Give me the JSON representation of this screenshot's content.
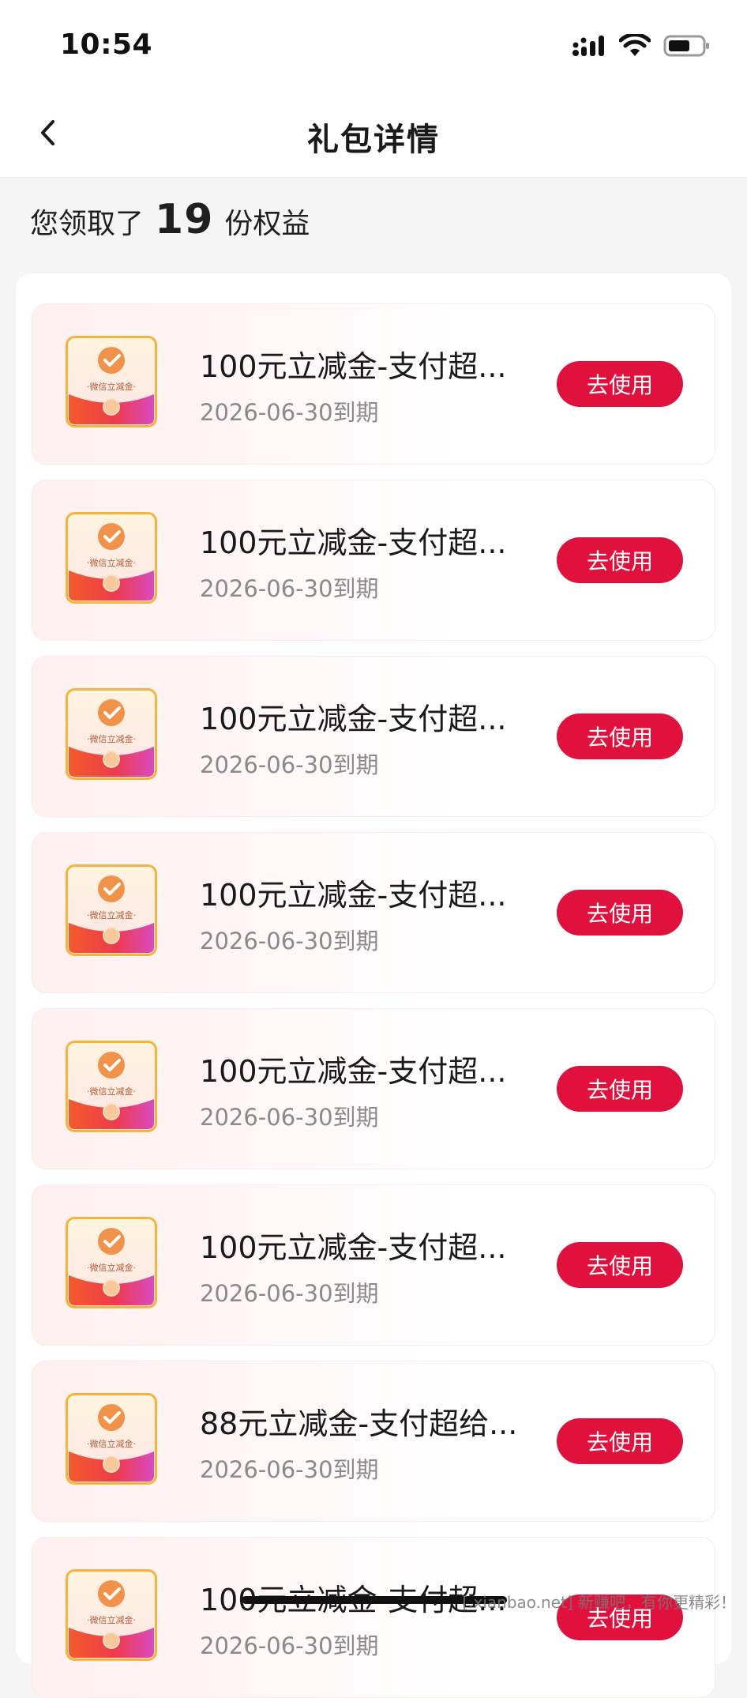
{
  "status_bar": {
    "time": "10:54"
  },
  "nav": {
    "title": "礼包详情"
  },
  "summary": {
    "prefix": "您领取了",
    "count": "19",
    "suffix": "份权益"
  },
  "coupon_badge_text": "·微信立减金·",
  "items": [
    {
      "title": "100元立减金-支付超...",
      "expiry": "2026-06-30到期",
      "button": "去使用"
    },
    {
      "title": "100元立减金-支付超...",
      "expiry": "2026-06-30到期",
      "button": "去使用"
    },
    {
      "title": "100元立减金-支付超...",
      "expiry": "2026-06-30到期",
      "button": "去使用"
    },
    {
      "title": "100元立减金-支付超...",
      "expiry": "2026-06-30到期",
      "button": "去使用"
    },
    {
      "title": "100元立减金-支付超...",
      "expiry": "2026-06-30到期",
      "button": "去使用"
    },
    {
      "title": "100元立减金-支付超...",
      "expiry": "2026-06-30到期",
      "button": "去使用"
    },
    {
      "title": "88元立减金-支付超给...",
      "expiry": "2026-06-30到期",
      "button": "去使用"
    },
    {
      "title": "100元立减金-支付超...",
      "expiry": "2026-06-30到期",
      "button": "去使用"
    }
  ],
  "watermark": "[.xianbao.net] 新赚吧，有你更精彩！",
  "colors": {
    "accent": "#e0113d",
    "page_bg": "#f5f5f5",
    "card_bg": "#ffffff"
  }
}
